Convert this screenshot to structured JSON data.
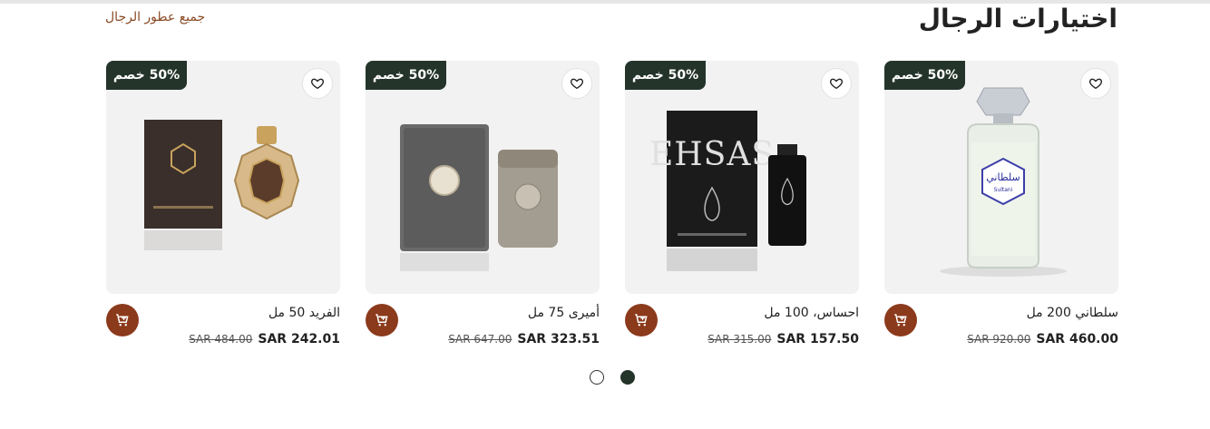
{
  "section": {
    "title": "اختيارات الرجال",
    "all_link": "جميع عطور الرجال"
  },
  "products": [
    {
      "name": "سلطاني 200 مل",
      "badge": "50% خصم",
      "old_price": "SAR 920.00",
      "new_price": "SAR 460.00"
    },
    {
      "name": "احساس، 100 مل",
      "badge": "50% خصم",
      "old_price": "SAR 315.00",
      "new_price": "SAR 157.50"
    },
    {
      "name": "أميرى 75 مل",
      "badge": "50% خصم",
      "old_price": "SAR 647.00",
      "new_price": "SAR 323.51"
    },
    {
      "name": "الفريد 50 مل",
      "badge": "50% خصم",
      "old_price": "SAR 484.00",
      "new_price": "SAR 242.01"
    }
  ],
  "icons": {
    "wishlist": "heart-icon",
    "cart": "cart-icon"
  },
  "colors": {
    "badge": "#24342b",
    "cart": "#8b3a1c",
    "link": "#8a4a24"
  },
  "pagination": {
    "pages": 2,
    "active": 2
  },
  "product_image_text": {
    "ehsas_brand": "EHSAS",
    "sultani_label": "Sultani"
  }
}
